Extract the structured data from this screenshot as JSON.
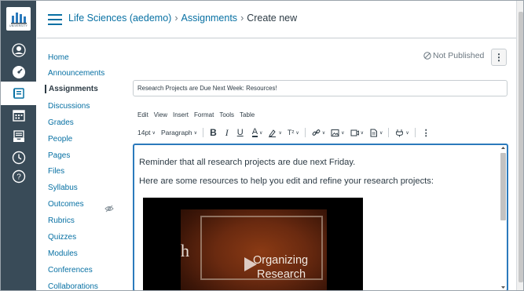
{
  "global_nav": {
    "logo_text": "UNIVERSITY",
    "items": [
      {
        "name": "account",
        "icon": "user-circle-icon"
      },
      {
        "name": "dashboard",
        "icon": "speedometer-icon"
      },
      {
        "name": "courses",
        "icon": "book-icon"
      },
      {
        "name": "calendar",
        "icon": "calendar-icon"
      },
      {
        "name": "inbox",
        "icon": "inbox-icon"
      },
      {
        "name": "history",
        "icon": "clock-icon"
      },
      {
        "name": "help",
        "icon": "question-icon"
      }
    ],
    "bg_color": "#394b58"
  },
  "header": {
    "course": "Life Sciences (aedemo)",
    "section": "Assignments",
    "page": "Create new"
  },
  "course_nav": {
    "items": [
      {
        "label": "Home",
        "active": false
      },
      {
        "label": "Announcements",
        "active": false
      },
      {
        "label": "Assignments",
        "active": true
      },
      {
        "label": "Discussions",
        "active": false
      },
      {
        "label": "Grades",
        "active": false
      },
      {
        "label": "People",
        "active": false
      },
      {
        "label": "Pages",
        "active": false
      },
      {
        "label": "Files",
        "active": false
      },
      {
        "label": "Syllabus",
        "active": false
      },
      {
        "label": "Outcomes",
        "active": false
      },
      {
        "label": "Rubrics",
        "active": false
      },
      {
        "label": "Quizzes",
        "active": false
      },
      {
        "label": "Modules",
        "active": false
      },
      {
        "label": "Conferences",
        "active": false
      },
      {
        "label": "Collaborations",
        "active": false
      }
    ],
    "link_color": "#0770a3"
  },
  "main": {
    "status": "Not Published",
    "kebab": "⋮",
    "title_value": "Research Projects are Due Next Week: Resources!",
    "menubar": [
      "Edit",
      "View",
      "Insert",
      "Format",
      "Tools",
      "Table"
    ],
    "toolbar": {
      "font_size": "14pt",
      "block_format": "Paragraph",
      "bold": "B",
      "italic": "I",
      "underline": "U",
      "text_color": "A",
      "superscript": "T²",
      "more": "⋮"
    },
    "editor": {
      "paragraph1": "Reminder that all research projects are due next Friday.",
      "paragraph2": "Here are some resources to help you edit and refine your research projects:",
      "video_letter": "h",
      "video_title_line1": "Organizing",
      "video_title_line2": "Research"
    },
    "accent_color": "#2b7abc"
  }
}
